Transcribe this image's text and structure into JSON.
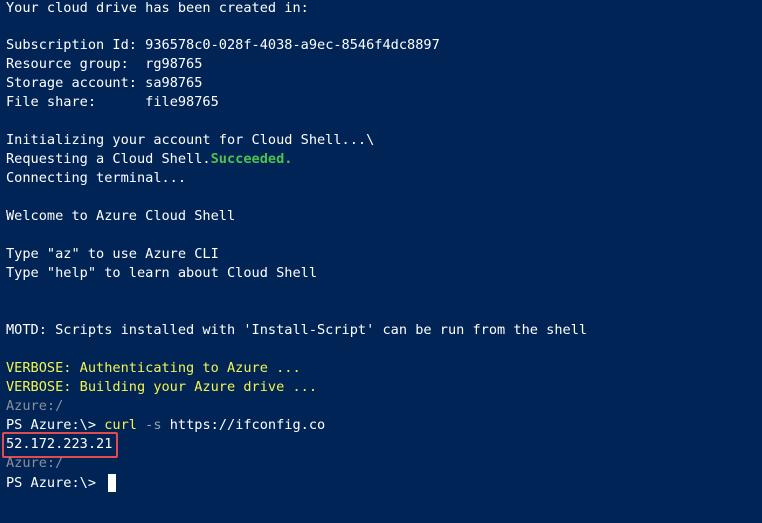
{
  "terminal": {
    "line_created": "Your cloud drive has been created in:",
    "line_sub_label": "Subscription Id: ",
    "line_sub_value": "936578c0-028f-4038-a9ec-8546f4dc8897",
    "line_rg_label": "Resource group:  ",
    "line_rg_value": "rg98765",
    "line_sa_label": "Storage account: ",
    "line_sa_value": "sa98765",
    "line_fs_label": "File share:      ",
    "line_fs_value": "file98765",
    "line_init": "Initializing your account for Cloud Shell...\\",
    "line_requesting": "Requesting a Cloud Shell.",
    "line_succeeded": "Succeeded.",
    "line_connecting": "Connecting terminal...",
    "line_welcome": "Welcome to Azure Cloud Shell",
    "line_type_az": "Type \"az\" to use Azure CLI",
    "line_type_help": "Type \"help\" to learn about Cloud Shell",
    "line_motd": "MOTD: Scripts installed with 'Install-Script' can be run from the shell",
    "line_verbose_auth": "VERBOSE: Authenticating to Azure ...",
    "line_verbose_build": "VERBOSE: Building your Azure drive ...",
    "line_azure_path_1": "Azure:/",
    "prompt_1": "PS Azure:\\> ",
    "cmd_name": "curl",
    "cmd_flag": " -s ",
    "cmd_arg": "https://ifconfig.co",
    "ip_output": "52.172.223.21",
    "line_azure_path_2": "Azure:/",
    "prompt_2": "PS Azure:\\> "
  },
  "colors": {
    "background": "#012456",
    "success": "#4ec24e",
    "verbose": "#f3f34d",
    "dim": "#8a8f99",
    "highlight_border": "#e34c4c"
  }
}
